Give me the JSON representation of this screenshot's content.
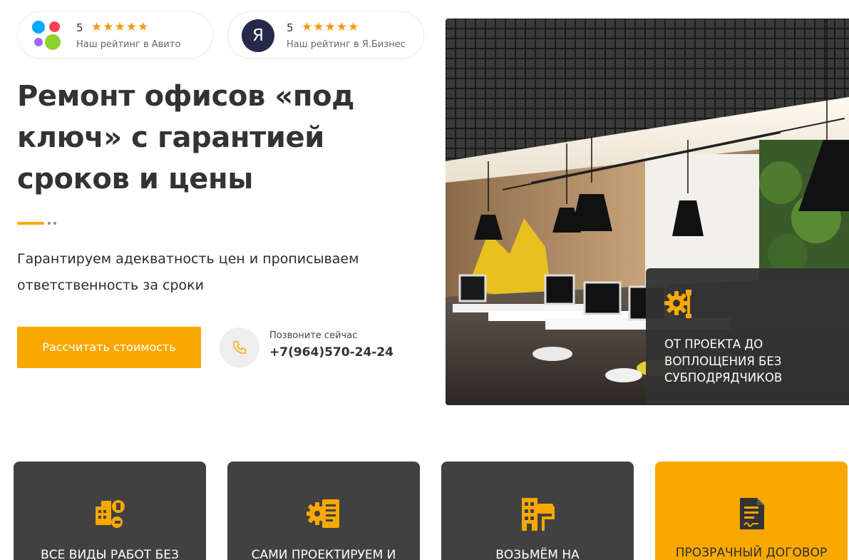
{
  "ratings": {
    "avito": {
      "score": "5",
      "stars": "★★★★★",
      "caption": "Наш рейтинг в Авито"
    },
    "yandex": {
      "logo_letter": "Я",
      "score": "5",
      "stars": "★★★★★",
      "caption": "Наш рейтинг в Я.Бизнес"
    }
  },
  "hero": {
    "title": "Ремонт офисов «под ключ» с гарантией сроков и цены",
    "subtitle": "Гарантируем адекватность цен и прописываем ответственность за сроки",
    "cta_label": "Рассчитать стоимость",
    "phone_label": "Позвоните сейчас",
    "phone_number": "+7(964)570-24-24"
  },
  "overlay": {
    "text": "ОТ ПРОЕКТА ДО ВОПЛОЩЕНИЯ БЕЗ СУБПОДРЯДЧИКОВ",
    "icon": "gear-wrench-icon"
  },
  "benefits": [
    {
      "text": "ВСЕ ВИДЫ РАБОТ БЕЗ",
      "icon": "building-tools-icon"
    },
    {
      "text": "САМИ ПРОЕКТИРУЕМ И",
      "icon": "gear-document-icon"
    },
    {
      "text": "ВОЗЬМЁМ НА",
      "icon": "building-roller-icon"
    },
    {
      "text": "ПРОЗРАЧНЫЙ ДОГОВОР",
      "icon": "contract-icon"
    }
  ],
  "colors": {
    "accent": "#f9a800",
    "dark_card": "#414141",
    "text": "#333333",
    "star": "#f59a12"
  }
}
